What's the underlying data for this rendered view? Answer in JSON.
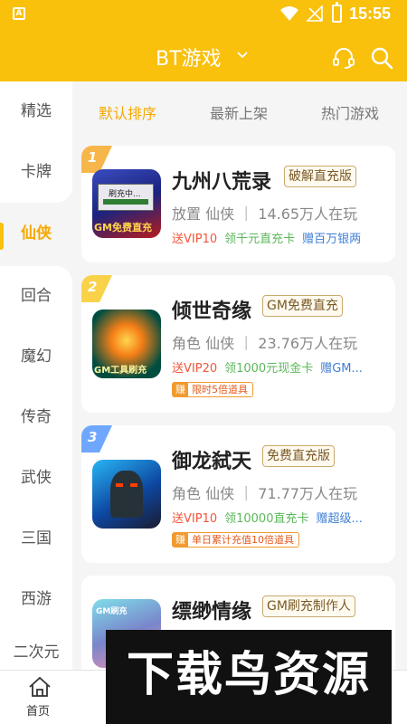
{
  "status": {
    "time": "15:55"
  },
  "header": {
    "title": "BT游戏"
  },
  "categories": [
    {
      "label": "精选"
    },
    {
      "label": "卡牌"
    },
    {
      "label": "仙侠"
    },
    {
      "label": "回合"
    },
    {
      "label": "魔幻"
    },
    {
      "label": "传奇"
    },
    {
      "label": "武侠"
    },
    {
      "label": "三国"
    },
    {
      "label": "西游"
    },
    {
      "label": "二次元"
    }
  ],
  "active_category": "仙侠",
  "tabs": [
    {
      "label": "默认排序"
    },
    {
      "label": "最新上架"
    },
    {
      "label": "热门游戏"
    }
  ],
  "games": [
    {
      "rank": "1",
      "name": "九州八荒录",
      "tag": "破解直充版",
      "meta": "放置 仙侠 ｜ 14.65万人在玩",
      "perk1": "送VIP10",
      "perk2": "领千元直充卡",
      "perk3": "赠百万银两",
      "promo_icon": "",
      "promo": "",
      "thumb_text_top": "刷充中...",
      "thumb_text_bottom": "GM免费直充"
    },
    {
      "rank": "2",
      "name": "倾世奇缘",
      "tag": "GM免费直充",
      "meta": "角色 仙侠 ｜ 23.76万人在玩",
      "perk1": "送VIP20",
      "perk2": "领1000元现金卡",
      "perk3": "赠GM...",
      "promo_icon": "赚",
      "promo": "限时5倍道具",
      "thumb_text_top": "",
      "thumb_text_bottom": "GM工具刷充"
    },
    {
      "rank": "3",
      "name": "御龙弑天",
      "tag": "免费直充版",
      "meta": "角色 仙侠 ｜ 71.77万人在玩",
      "perk1": "送VIP10",
      "perk2": "领10000直充卡",
      "perk3": "赠超级...",
      "promo_icon": "赚",
      "promo": "单日累计充值10倍道具",
      "thumb_text_top": "",
      "thumb_text_bottom": ""
    },
    {
      "rank": "",
      "name": "缥缈情缘",
      "tag": "GM刷充制作人",
      "meta": "",
      "perk1": "",
      "perk2": "",
      "perk3": "",
      "promo_icon": "",
      "promo": "",
      "thumb_text_top": "GM刷充",
      "thumb_text_bottom": ""
    }
  ],
  "bottom_nav": {
    "home_label": "首页"
  },
  "watermark": "下载鸟资源",
  "colors": {
    "accent": "#f9c00c",
    "active_text": "#f6a800",
    "rank1": "#f7b64a",
    "rank2": "#f9d24a",
    "rank3": "#6fa7ff"
  }
}
